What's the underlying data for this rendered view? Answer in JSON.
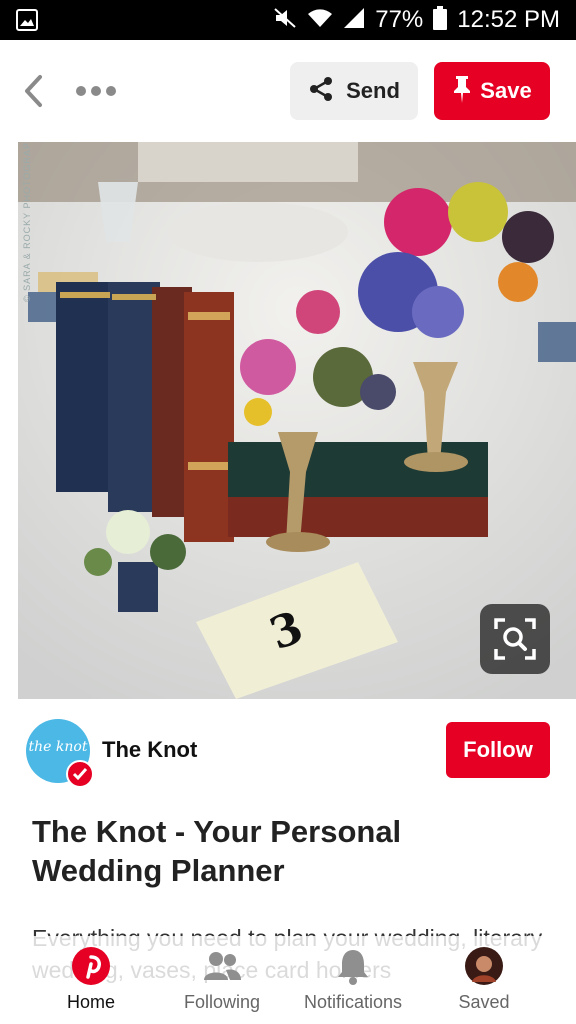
{
  "status_bar": {
    "battery": "77%",
    "time": "12:52 PM",
    "icons": [
      "gallery-icon",
      "mute-icon",
      "wifi-icon",
      "signal-icon",
      "battery-icon"
    ]
  },
  "top_bar": {
    "send_label": "Send",
    "save_label": "Save",
    "icons": [
      "back-arrow-icon",
      "more-icon",
      "share-icon",
      "pin-icon"
    ]
  },
  "pin": {
    "image_description_icons": [
      "visual-search-icon"
    ],
    "watermark": "© SARA & ROCKY PHOTOGRAPHY",
    "table_number": "3"
  },
  "creator": {
    "avatar_text": "the knot",
    "name": "The Knot",
    "follow_label": "Follow"
  },
  "content": {
    "title": "The Knot - Your Personal Wedding Planner",
    "description": "Everything you need to plan your wedding, literary wedding, vases, place card holders"
  },
  "bottom_nav": {
    "items": [
      {
        "label": "Home",
        "icon": "pinterest-icon",
        "active": true
      },
      {
        "label": "Following",
        "icon": "people-icon",
        "active": false
      },
      {
        "label": "Notifications",
        "icon": "bell-icon",
        "active": false
      },
      {
        "label": "Saved",
        "icon": "profile-avatar",
        "active": false
      }
    ]
  },
  "colors": {
    "brand_red": "#e60023",
    "knot_blue": "#4bb8e6",
    "send_bg": "#efefef"
  }
}
